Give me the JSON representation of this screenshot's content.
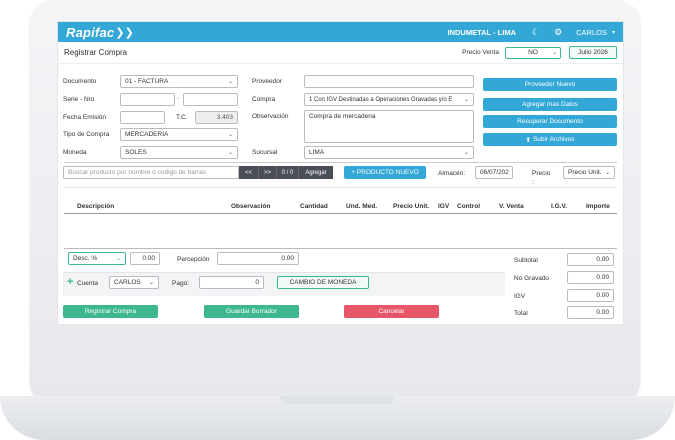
{
  "topbar": {
    "logo": "Rapifac",
    "company": "INDUMETAL - LIMA",
    "user": "CARLOS"
  },
  "header": {
    "title": "Registrar Compra",
    "precio_venta_label": "Precio Venta",
    "precio_venta_value": "NO",
    "period": "Julio 2026"
  },
  "form": {
    "documento_label": "Documento",
    "documento_value": "01 - FACTURA",
    "serie_label": "Serie - Nro",
    "serie_sep": "-",
    "fecha_label": "Fecha Emisión",
    "tc_label": "T.C.",
    "tc_value": "3.403",
    "tipo_label": "Tipo de Compra",
    "tipo_value": "MERCADERIA",
    "moneda_label": "Moneda",
    "moneda_value": "SOLES",
    "proveedor_label": "Proveedor",
    "compra_label": "Compra",
    "compra_value": "1 Con IGV Destinadas a Operaciones Gravadas y/o E",
    "observacion_label": "Observación",
    "observacion_value": "Compra de mercaderia",
    "sucursal_label": "Sucursal",
    "sucursal_value": "LIMA"
  },
  "actions": {
    "proveedor_nuevo": "Proveedor Nuevo",
    "agregar_datos": "Agregar mas Datos",
    "recuperar": "Recuperar Documento",
    "subir": "Subir Archivos"
  },
  "search": {
    "placeholder": "Buscar producto por nombre o codigo de barras",
    "prev": "<<",
    "next": ">>",
    "counter": "0 / 0",
    "agregar": "Agregar",
    "producto_nuevo": "+ PRODUCTO NUEVO",
    "almacen_label": "Almacén:",
    "almacen_value": "06/07/202",
    "precio_label": "Precio :",
    "precio_value": "Precio Unit."
  },
  "table": {
    "columns": [
      "Descripción",
      "Observación",
      "Cantidad",
      "Und. Med.",
      "Precio Unit.",
      "IGV",
      "Control",
      "V. Venta",
      "I.G.V.",
      "Importe"
    ]
  },
  "bottom": {
    "desc_label": "Desc. %",
    "desc_value": "0.00",
    "percepcion_label": "Percepción",
    "percepcion_value": "0.00",
    "cuenta_label": "Cuenta",
    "cuenta_value": "CARLOS",
    "pago_label": "Pago:",
    "pago_value": "0",
    "cambio": "CAMBIO DE MONEDA",
    "registrar": "Registrar Compra",
    "guardar": "Guardar Borrador",
    "cancelar": "Cancelar"
  },
  "totals": [
    {
      "label": "Subtotal",
      "value": "0.00"
    },
    {
      "label": "No Gravado",
      "value": "0.00"
    },
    {
      "label": "IGV",
      "value": "0.00"
    },
    {
      "label": "Total",
      "value": "0.00"
    }
  ],
  "colors": {
    "accent": "#33a8d6",
    "green": "#3db78e",
    "red": "#e8566a",
    "dark": "#4a4f57"
  }
}
